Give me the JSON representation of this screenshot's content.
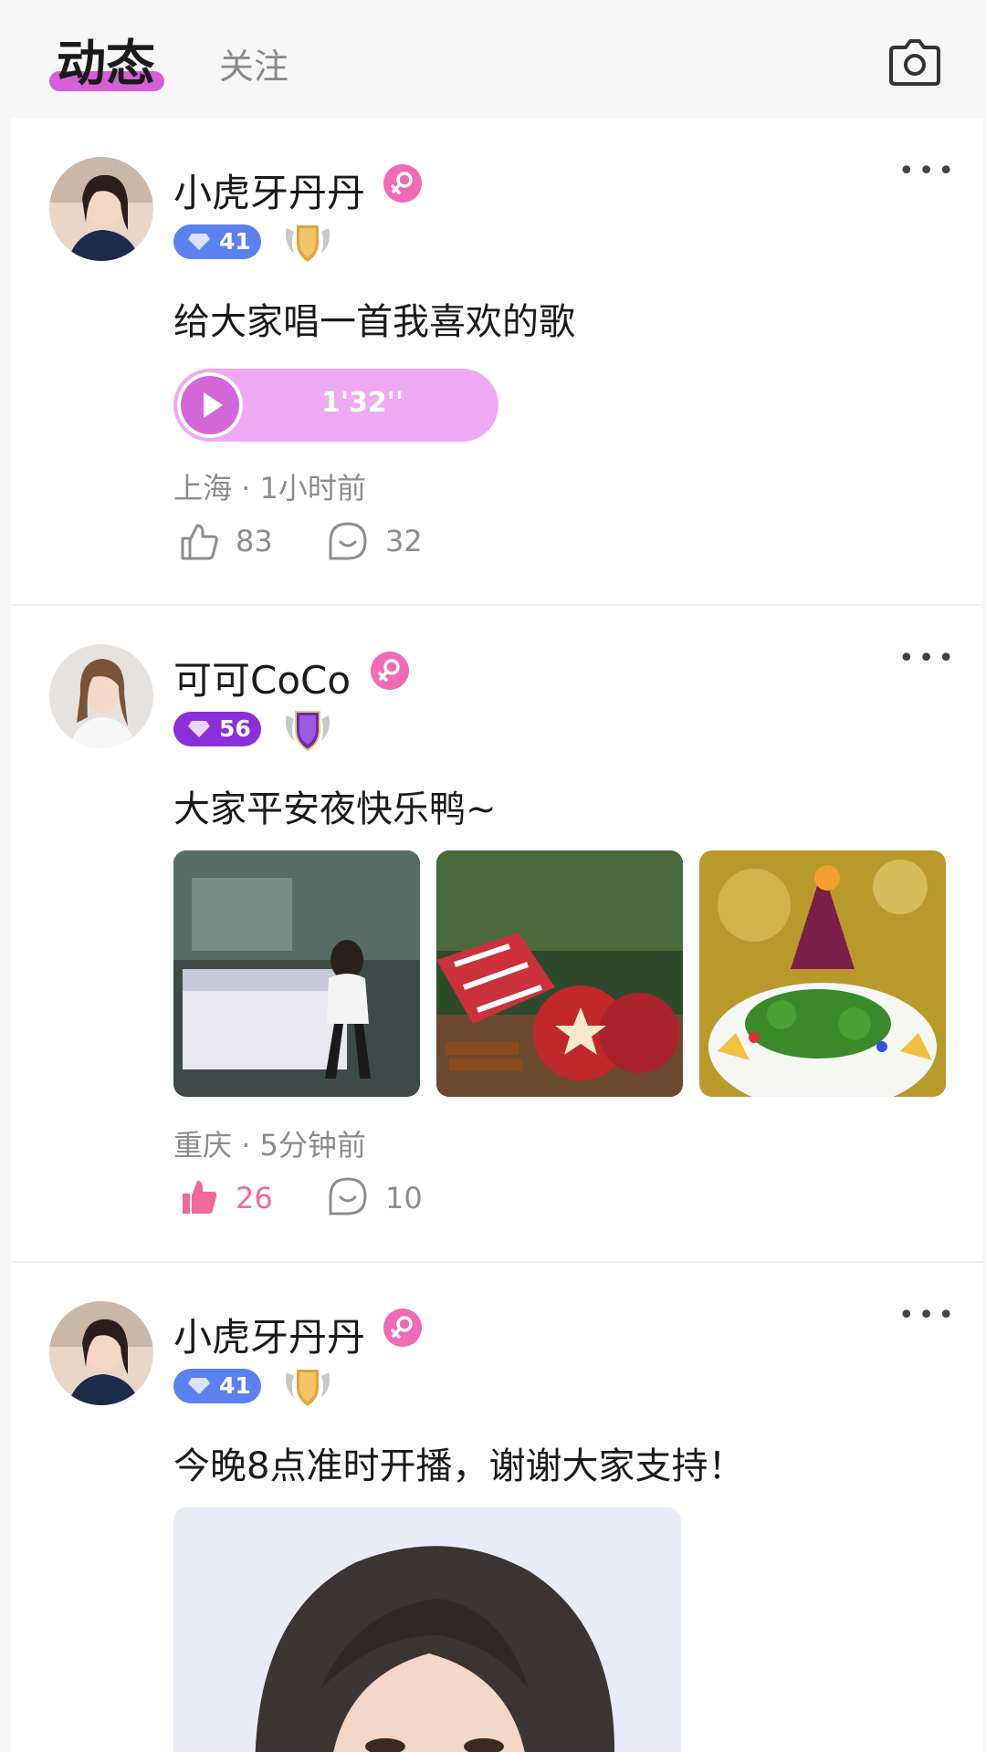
{
  "header": {
    "tab_active": "动态",
    "tab_follow": "关注",
    "camera_icon": "camera-icon"
  },
  "colors": {
    "accent": "#d85ed8",
    "female": "#f06bb3",
    "liked": "#f0699a",
    "level_blue": "#5b80f0",
    "level_purple": "#8a30d8",
    "audio_bg": "#eeaaf2"
  },
  "posts": [
    {
      "username": "小虎牙丹丹",
      "level": "41",
      "content": "给大家唱一首我喜欢的歌",
      "audio_duration": "1'32''",
      "location": "上海",
      "time": "1小时前",
      "likes": "83",
      "comments": "32",
      "liked": false
    },
    {
      "username": "可可CoCo",
      "level": "56",
      "content": "大家平安夜快乐鸭~",
      "location": "重庆",
      "time": "5分钟前",
      "likes": "26",
      "comments": "10",
      "liked": true
    },
    {
      "username": "小虎牙丹丹",
      "level": "41",
      "content": "今晚8点准时开播，谢谢大家支持！"
    }
  ],
  "separator": "·"
}
